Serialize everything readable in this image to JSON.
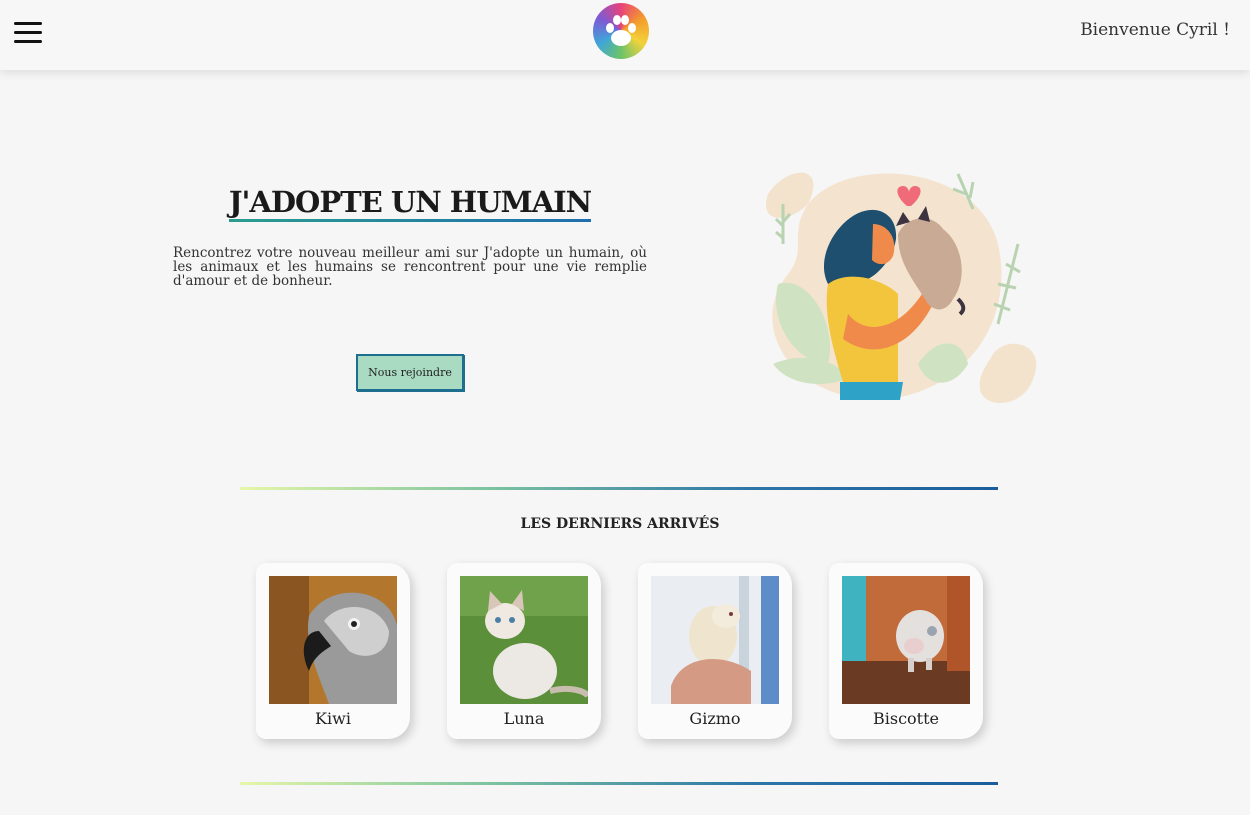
{
  "header": {
    "welcome_text": "Bienvenue Cyril !",
    "logo_icon": "paw-print-icon",
    "menu_icon": "hamburger-menu-icon"
  },
  "hero": {
    "title": "J'ADOPTE UN HUMAIN",
    "description": "Rencontrez votre nouveau meilleur ami sur J'adopte un humain, où les animaux et les humains se rencontrent pour une vie remplie d'amour et de bonheur.",
    "join_button": "Nous rejoindre",
    "illustration": "woman-hugging-cat-illustration"
  },
  "latest": {
    "title": "LES DERNIERS ARRIVÉS",
    "animals": [
      {
        "name": "Kiwi",
        "photo": "grey-parrot-photo"
      },
      {
        "name": "Luna",
        "photo": "white-cat-photo"
      },
      {
        "name": "Gizmo",
        "photo": "ferret-photo"
      },
      {
        "name": "Biscotte",
        "photo": "pig-photo"
      }
    ]
  },
  "colors": {
    "accent_green": "#a8dbc2",
    "accent_blue": "#1e6f8f",
    "background": "#f6f6f6"
  }
}
